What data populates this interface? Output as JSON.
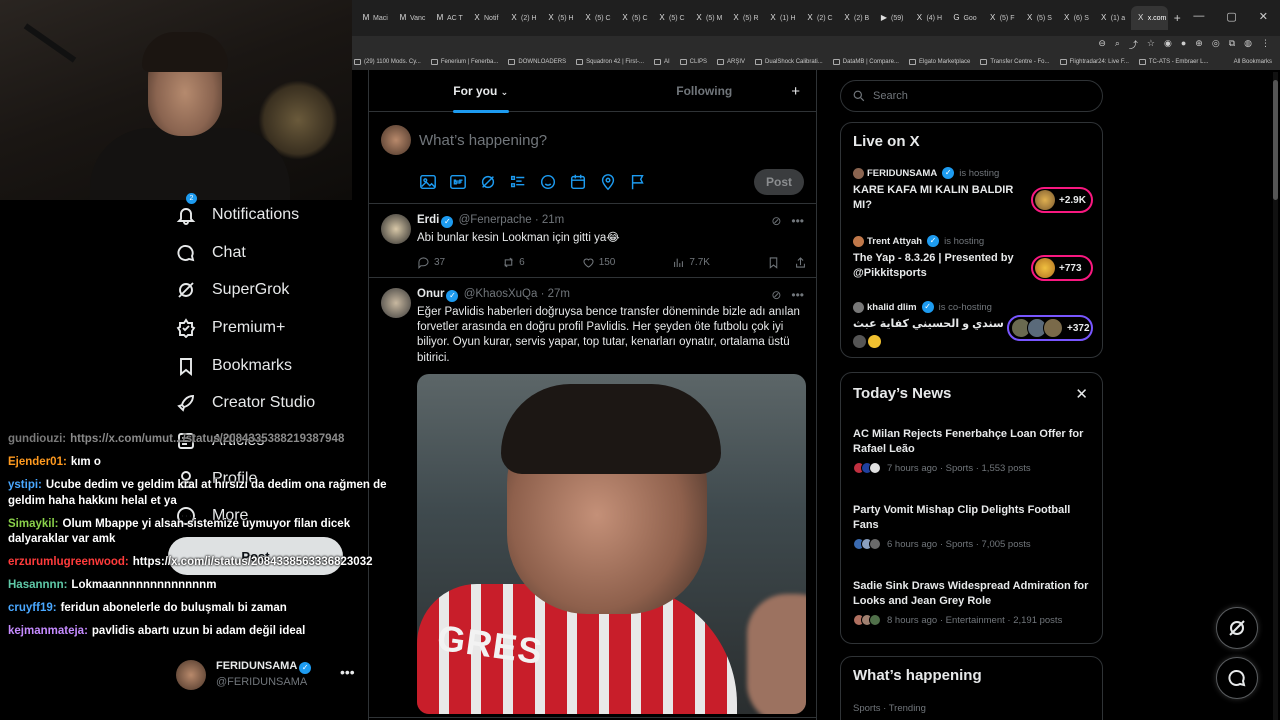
{
  "browser": {
    "tabs": [
      {
        "label": "Maci",
        "icon": "M"
      },
      {
        "label": "Vanc",
        "icon": "M"
      },
      {
        "label": "AC T",
        "icon": "M"
      },
      {
        "label": "Notif",
        "icon": "X"
      },
      {
        "label": "(2) H",
        "icon": "X"
      },
      {
        "label": "(5) H",
        "icon": "X"
      },
      {
        "label": "(5) C",
        "icon": "X"
      },
      {
        "label": "(5) C",
        "icon": "X"
      },
      {
        "label": "(5) C",
        "icon": "X"
      },
      {
        "label": "(5) M",
        "icon": "X"
      },
      {
        "label": "(5) R",
        "icon": "X"
      },
      {
        "label": "(1) H",
        "icon": "X"
      },
      {
        "label": "(2) C",
        "icon": "X"
      },
      {
        "label": "(2) B",
        "icon": "X"
      },
      {
        "label": "(59)",
        "icon": "▶"
      },
      {
        "label": "(4) H",
        "icon": "X"
      },
      {
        "label": "Goo",
        "icon": "G"
      },
      {
        "label": "(5) F",
        "icon": "X"
      },
      {
        "label": "(5) S",
        "icon": "X"
      },
      {
        "label": "(6) S",
        "icon": "X"
      },
      {
        "label": "(1) a",
        "icon": "X"
      },
      {
        "label": "x.com",
        "icon": "X"
      }
    ],
    "bookmarks": [
      "(29) 1100 Mods. Cy...",
      "Fenerium | Fenerba...",
      "DOWNLOADERS",
      "Squadron 42 | First-...",
      "AI",
      "CLIPS",
      "ARŞIV",
      "DualShock Calibrati...",
      "DataMB | Compare...",
      "Elgato Marketplace",
      "Transfer Centre - Fo...",
      "Flightradar24: Live F...",
      "TC-ATS - Embraer L..."
    ],
    "all_bookmarks": "All Bookmarks"
  },
  "nav": {
    "notif_badge": "2",
    "items": [
      {
        "label": "Notifications",
        "icon": "bell-icon"
      },
      {
        "label": "Chat",
        "icon": "chat-icon"
      },
      {
        "label": "SuperGrok",
        "icon": "grok-icon"
      },
      {
        "label": "Premium+",
        "icon": "premium-icon"
      },
      {
        "label": "Bookmarks",
        "icon": "bookmark-icon"
      },
      {
        "label": "Creator Studio",
        "icon": "rocket-icon"
      },
      {
        "label": "Articles",
        "icon": "articles-icon"
      },
      {
        "label": "Profile",
        "icon": "profile-icon"
      },
      {
        "label": "More",
        "icon": "more-icon"
      }
    ],
    "post_label": "Post",
    "profile": {
      "name": "FERIDUNSAMA",
      "handle": "@FERIDUNSAMA",
      "more": "•••"
    }
  },
  "chat": [
    {
      "user": "gundiouzi:",
      "color": "#7a7a7a",
      "msg": "https://x.com/umut.../status/2084335388219387948",
      "msg_color": "#8a8a8a"
    },
    {
      "user": "Ejender01:",
      "color": "#ff9a1f",
      "msg": "kım o"
    },
    {
      "user": "ystipi:",
      "color": "#4aa8ff",
      "msg": "Ucube dedim ve geldim kral at hırsızı da dedim ona rağmen de geldim haha hakkını helal et ya"
    },
    {
      "user": "Simaykil:",
      "color": "#8ad14a",
      "msg": "Olum Mbappe yi alsan sistemize uymuyor filan dicek dalyaraklar var amk"
    },
    {
      "user": "erzurumlugreenwood:",
      "color": "#ff3b3b",
      "msg": "https://x.com/i/status/2084338563336823032"
    },
    {
      "user": "Hasannnn:",
      "color": "#5fc9a8",
      "msg": "Lokmaannnnnnnnnnnnnm"
    },
    {
      "user": "cruyff19:",
      "color": "#4aa8ff",
      "msg": "feridun abonelerle do buluşmalı bi zaman"
    },
    {
      "user": "kejmanmateja:",
      "color": "#c58bff",
      "msg": "pavlidis abartı uzun bi adam değil ideal"
    }
  ],
  "feed": {
    "tabs": {
      "for_you": "For you",
      "following": "Following",
      "add": "+"
    },
    "composer": {
      "placeholder": "What’s happening?",
      "post": "Post"
    },
    "tweets": [
      {
        "name": "Erdi",
        "handle": "@Fenerpache",
        "time": "21m",
        "text": "Abi bunlar kesin Lookman için gitti ya😂",
        "replies": "37",
        "reposts": "6",
        "likes": "150",
        "views": "7.7K"
      },
      {
        "name": "Onur",
        "handle": "@KhaosXuQa",
        "time": "27m",
        "text": "Eğer Pavlidis haberleri doğruysa bence transfer döneminde bizle adı anılan forvetler arasında en doğru profil Pavlidis. Her şeyden öte futbolu çok iyi biliyor. Oyun kurar, servis yapar, top tutar, kenarları oynatır, ortalama üstü bitirici.",
        "media_text": "GRES"
      }
    ]
  },
  "right": {
    "search_placeholder": "Search",
    "live": {
      "title": "Live on X",
      "items": [
        {
          "host": "FERIDUNSAMA",
          "role": "is hosting",
          "title": "KARE KAFA MI KALIN BALDIR MI?",
          "count": "+2.9K"
        },
        {
          "host": "Trent Attyah",
          "role": "is hosting",
          "title": "The Yap - 8.3.26 | Presented by @Pikkitsports",
          "count": "+773"
        },
        {
          "host": "khalid dlim",
          "role": "is co-hosting",
          "title": "سندي و الحسيني كفاية عبث",
          "count": "+372"
        }
      ]
    },
    "news": {
      "title": "Today’s News",
      "close": "✕",
      "items": [
        {
          "title": "AC Milan Rejects Fenerbahçe Loan Offer for Rafael Leão",
          "meta": "7 hours ago · Sports · 1,553 posts"
        },
        {
          "title": "Party Vomit Mishap Clip Delights Football Fans",
          "meta": "6 hours ago · Sports · 7,005 posts"
        },
        {
          "title": "Sadie Sink Draws Widespread Admiration for Looks and Jean Grey Role",
          "meta": "8 hours ago · Entertainment · 2,191 posts"
        }
      ]
    },
    "happening": {
      "title": "What’s happening",
      "sub": "Sports · Trending"
    }
  },
  "colors": {
    "accent": "#1d9bf0",
    "live_pink": "#f91880",
    "live_purple": "#7856ff",
    "background": "#000000"
  }
}
